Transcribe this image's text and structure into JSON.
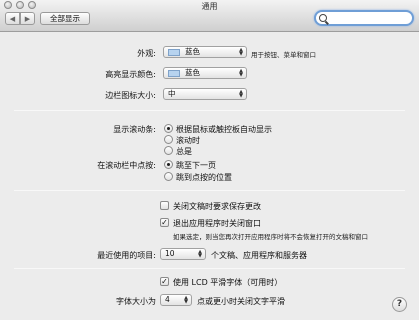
{
  "window": {
    "title": "通用"
  },
  "toolbar": {
    "back_icon": "chevron-left-icon",
    "forward_icon": "chevron-right-icon",
    "show_all_label": "全部显示",
    "search_value": ""
  },
  "appearance": {
    "label": "外观:",
    "value": "蓝色",
    "note": "用于按钮、菜单和窗口",
    "swatch_color": "#b7d3ef"
  },
  "highlight": {
    "label": "高亮显示颜色:",
    "value": "蓝色",
    "swatch_color": "#b7d3ef"
  },
  "sidebar_icon_size": {
    "label": "边栏图标大小:",
    "value": "中"
  },
  "show_scrollbars": {
    "label": "显示滚动条:",
    "options": [
      "根据鼠标或触控板自动显示",
      "滚动时",
      "总是"
    ],
    "selected": 0
  },
  "click_scrollbar": {
    "label": "在滚动栏中点按:",
    "options": [
      "跳至下一页",
      "跳到点按的位置"
    ],
    "selected": 0
  },
  "ask_keep_changes": {
    "label": "关闭文稿时要求保存更改",
    "checked": false
  },
  "close_windows_on_quit": {
    "label": "退出应用程序时关闭窗口",
    "checked": true,
    "note": "如果选定，则当您再次打开应用程序时将不会恢复打开的文稿和窗口"
  },
  "recent_items": {
    "label": "最近使用的项目:",
    "value": "10",
    "suffix": "个文稿、应用程序和服务器"
  },
  "lcd_smoothing": {
    "label": "使用 LCD 平滑字体（可用时）",
    "checked": true
  },
  "font_smoothing": {
    "label": "字体大小为",
    "value": "4",
    "suffix": "点或更小时关闭文字平滑"
  },
  "help": {
    "label": "?"
  }
}
